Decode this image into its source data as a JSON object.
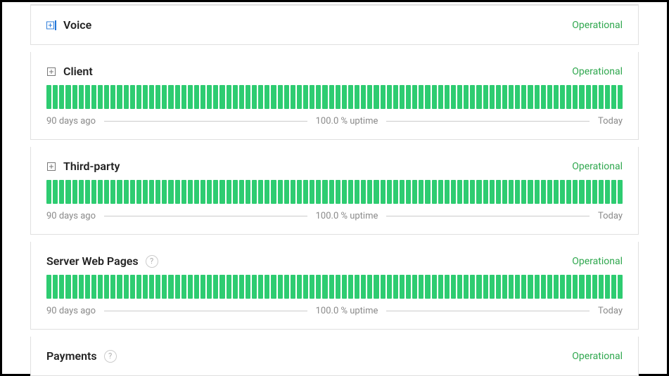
{
  "status_text": "Operational",
  "status_color": "#2fa74e",
  "bar_color": "#2ecc71",
  "footer": {
    "left": "90 days ago",
    "center": "100.0 % uptime",
    "right": "Today"
  },
  "components": [
    {
      "name": "Voice",
      "expandable": true,
      "expand_style": "blue",
      "has_help": false,
      "has_graph": false
    },
    {
      "name": "Client",
      "expandable": true,
      "expand_style": "gray",
      "has_help": false,
      "has_graph": true
    },
    {
      "name": "Third-party",
      "expandable": true,
      "expand_style": "gray",
      "has_help": false,
      "has_graph": true
    },
    {
      "name": "Server Web Pages",
      "expandable": false,
      "expand_style": "",
      "has_help": true,
      "has_graph": true
    },
    {
      "name": "Payments",
      "expandable": false,
      "expand_style": "",
      "has_help": true,
      "has_graph": false
    }
  ],
  "help_symbol": "?",
  "bars_count": 90
}
